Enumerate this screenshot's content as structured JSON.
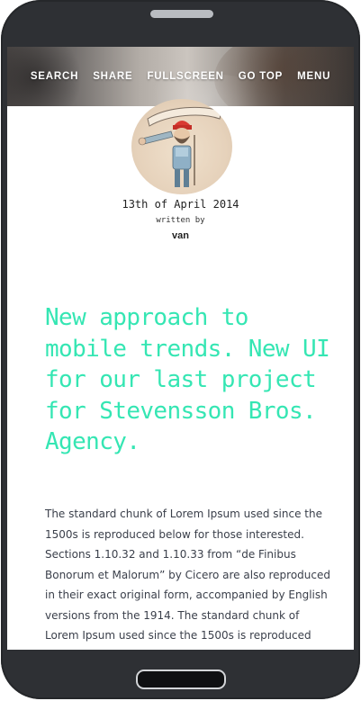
{
  "nav": {
    "items": [
      "SEARCH",
      "SHARE",
      "FULLSCREEN",
      "GO TOP",
      "MENU"
    ]
  },
  "post": {
    "date": "13th of April 2014",
    "written_by": "written by",
    "author": "van",
    "headline": "New approach to mobile trends. New UI for our last project for Stevensson Bros. Agency.",
    "body": "The standard chunk of Lorem Ipsum used since the 1500s is reproduced below for those interested. Sections 1.10.32 and 1.10.33 from “de Finibus Bonorum et Malorum” by Cicero are also reproduced in their exact original form, accompanied by English versions from the 1914. The standard chunk of Lorem Ipsum used since the 1500s is reproduced"
  },
  "colors": {
    "accent": "#35e6b3",
    "phone_body": "#2e3034",
    "body_text": "#3a3f4a"
  }
}
